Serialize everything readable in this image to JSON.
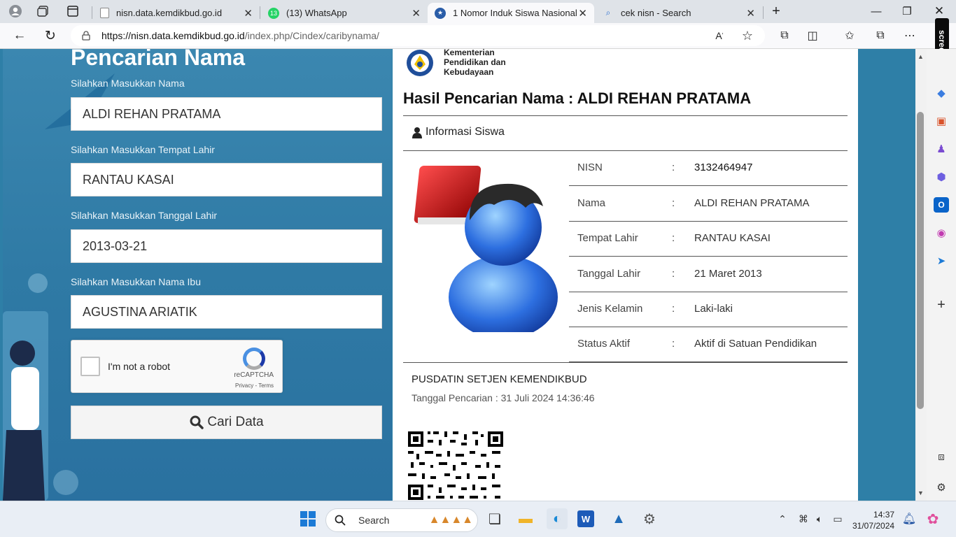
{
  "browser": {
    "tabs": [
      {
        "title": "nisn.data.kemdikbud.go.id",
        "active": false
      },
      {
        "title": "(13) WhatsApp",
        "active": false
      },
      {
        "title": "1 Nomor Induk Siswa Nasional",
        "active": true
      },
      {
        "title": "cek nisn - Search",
        "active": false
      }
    ],
    "whatsapp_badge": "13",
    "url_host": "https://nisn.data.kemdikbud.go.id",
    "url_path": "/index.php/Cindex/caribynama/"
  },
  "extension": {
    "screenrec": "screenrec"
  },
  "form": {
    "title": "Pencarian Nama",
    "name_label": "Silahkan Masukkan Nama",
    "name_value": "ALDI REHAN PRATAMA",
    "birthplace_label": "Silahkan Masukkan Tempat Lahir",
    "birthplace_value": "RANTAU KASAI",
    "birthdate_label": "Silahkan Masukkan Tanggal Lahir",
    "birthdate_value": "2013-03-21",
    "mother_label": "Silahkan Masukkan Nama Ibu",
    "mother_value": "AGUSTINA ARIATIK",
    "captcha_text": "I'm not a robot",
    "captcha_brand": "reCAPTCHA",
    "captcha_terms": "Privacy - Terms",
    "search_button": "Cari Data"
  },
  "result": {
    "ministry_line1": "Kementerian",
    "ministry_line2": "Pendidikan dan",
    "ministry_line3": "Kebudayaan",
    "title": "Hasil Pencarian Nama : ALDI REHAN PRATAMA",
    "section": "Informasi Siswa",
    "rows": [
      {
        "key": "NISN",
        "sep": ":",
        "value": "3132464947"
      },
      {
        "key": "Nama",
        "sep": ":",
        "value": "ALDI REHAN PRATAMA"
      },
      {
        "key": "Tempat Lahir",
        "sep": ":",
        "value": "RANTAU KASAI"
      },
      {
        "key": "Tanggal Lahir",
        "sep": ":",
        "value": "21 Maret 2013"
      },
      {
        "key": "Jenis Kelamin",
        "sep": ":",
        "value": "Laki-laki"
      },
      {
        "key": "Status Aktif",
        "sep": ":",
        "value": "Aktif di Satuan Pendidikan"
      }
    ],
    "org": "PUSDATIN SETJEN KEMENDIKBUD",
    "search_date": "Tanggal Pencarian : 31 Juli 2024 14:36:46"
  },
  "taskbar": {
    "search_placeholder": "Search",
    "time": "14:37",
    "date": "31/07/2024"
  },
  "colors": {
    "page_bg": "#2e7fa7",
    "accent": "#0067c0"
  }
}
